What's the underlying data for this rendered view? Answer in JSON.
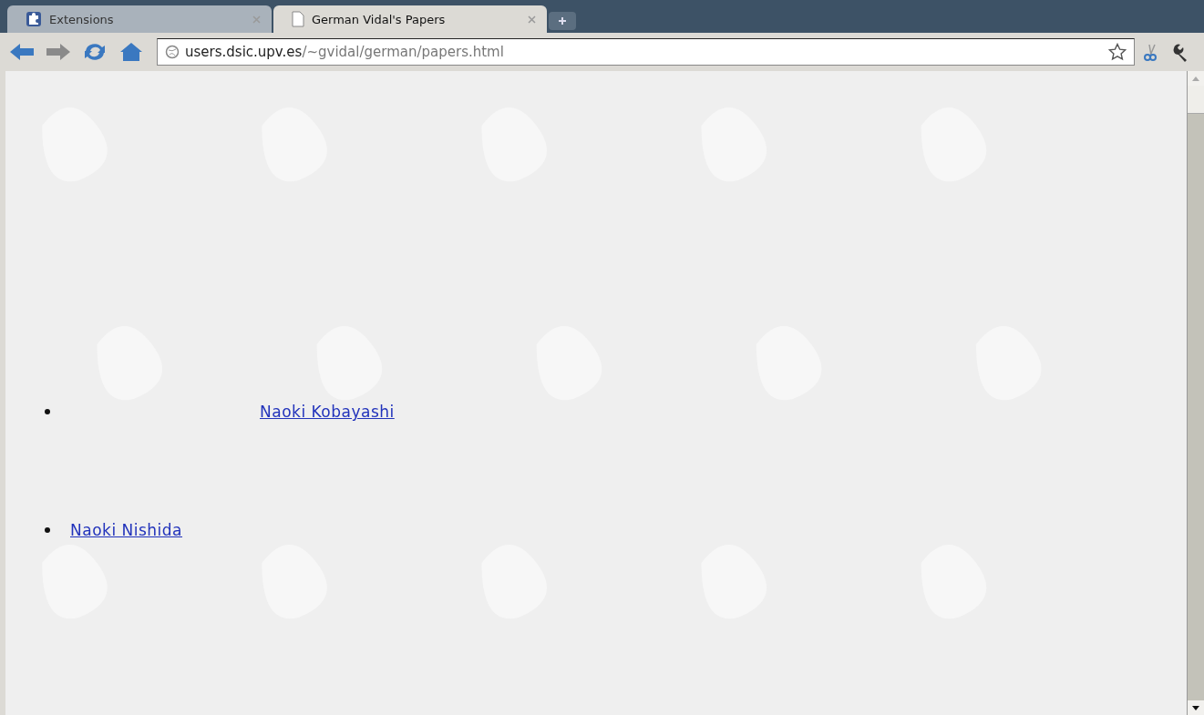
{
  "tabs": [
    {
      "label": "Extensions",
      "kind": "extension",
      "selected": false
    },
    {
      "label": "German Vidal's Papers",
      "kind": "page",
      "selected": true
    }
  ],
  "address_bar": {
    "host": "users.dsic.upv.es",
    "path": "/~gvidal/german/papers.html"
  },
  "links": [
    "Naoki Kobayashi",
    "Naoki Nishida"
  ]
}
